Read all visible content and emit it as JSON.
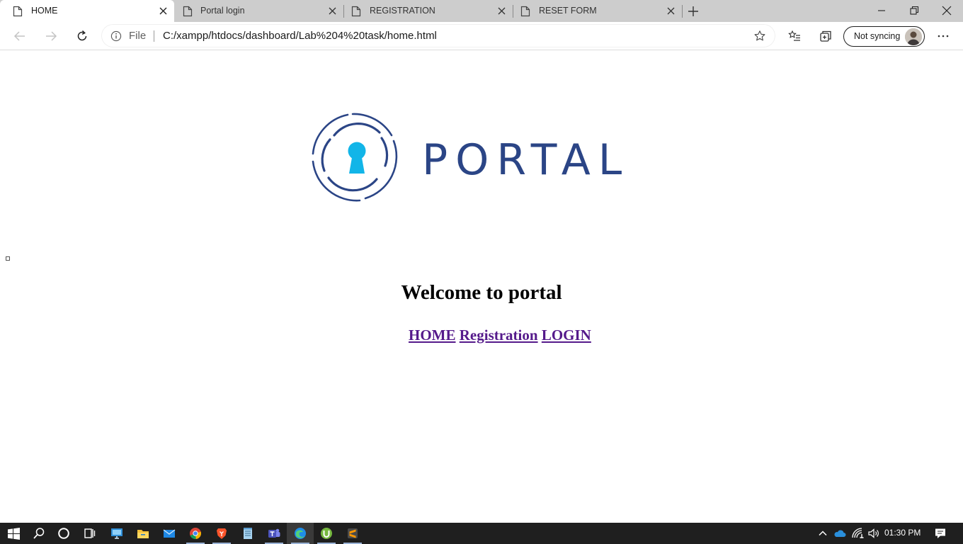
{
  "browser": {
    "tabs": [
      {
        "label": "HOME",
        "active": true
      },
      {
        "label": "Portal login",
        "active": false
      },
      {
        "label": "REGISTRATION",
        "active": false
      },
      {
        "label": "RESET FORM",
        "active": false
      }
    ],
    "address": {
      "scheme_label": "File",
      "url": "C:/xampp/htdocs/dashboard/Lab%204%20task/home.html"
    },
    "profile_status": "Not syncing"
  },
  "page": {
    "logo_text": "PORTAL",
    "heading": "Welcome to portal",
    "nav_links": [
      "HOME",
      "Registration",
      "LOGIN"
    ],
    "link_color": "#551a8b",
    "logo_ring_color": "#2b4586",
    "logo_keyhole_color": "#12b5e8"
  },
  "taskbar": {
    "apps": [
      "start-icon",
      "search-icon",
      "cortana-icon",
      "task-view-icon",
      "pc-icon",
      "file-explorer-icon",
      "mail-icon",
      "chrome-icon",
      "brave-icon",
      "notepad-icon",
      "teams-icon",
      "edge-icon",
      "utorrent-icon",
      "sublime-text-icon"
    ],
    "clock": "01:30 PM"
  }
}
